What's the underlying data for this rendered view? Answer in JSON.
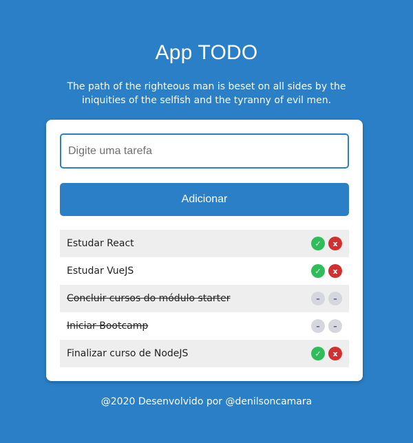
{
  "header": {
    "title": "App TODO",
    "subtitle": "The path of the righteous man is beset on all sides by the iniquities of the selfish and the tyranny of evil men."
  },
  "form": {
    "placeholder": "Digite uma tarefa",
    "value": "",
    "add_label": "Adicionar"
  },
  "tasks": [
    {
      "label": "Estudar React",
      "done": false,
      "check_glyph": "✓",
      "remove_glyph": "x"
    },
    {
      "label": "Estudar VueJS",
      "done": false,
      "check_glyph": "✓",
      "remove_glyph": "x"
    },
    {
      "label": "Concluir cursos do módulo starter",
      "done": true,
      "check_glyph": "–",
      "remove_glyph": "–"
    },
    {
      "label": "Iniciar Bootcamp",
      "done": true,
      "check_glyph": "–",
      "remove_glyph": "–"
    },
    {
      "label": "Finalizar curso de NodeJS",
      "done": false,
      "check_glyph": "✓",
      "remove_glyph": "x"
    }
  ],
  "footer": {
    "text": "@2020 Desenvolvido por @denilsoncamara"
  },
  "colors": {
    "background": "#2a7fc7",
    "primary": "#2a7fc7",
    "check": "#2ebd59",
    "remove": "#d03030",
    "disabled": "#d6d6de"
  },
  "icons": {
    "check": "check-icon",
    "remove": "close-icon",
    "disabled": "dash-icon"
  }
}
